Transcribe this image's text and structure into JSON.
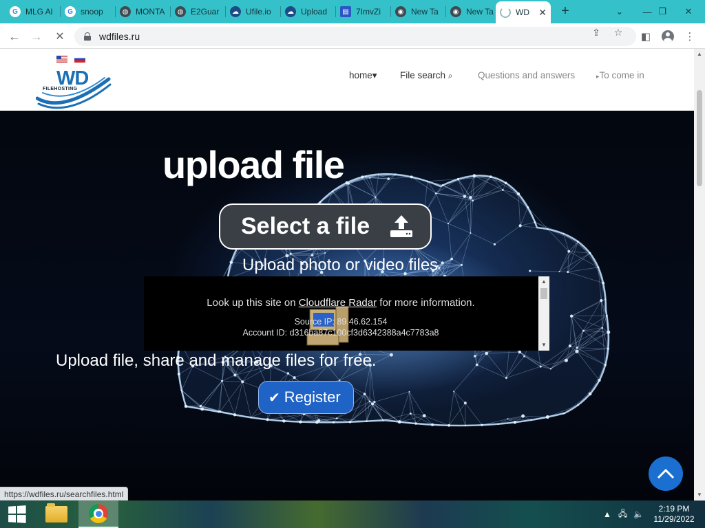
{
  "browser": {
    "tabs": [
      {
        "title": "MLG Al",
        "icon": "google-icon"
      },
      {
        "title": "snoop",
        "icon": "google-icon"
      },
      {
        "title": "MONTA",
        "icon": "globe-icon"
      },
      {
        "title": "E2Guar",
        "icon": "globe-icon"
      },
      {
        "title": "Ufile.io",
        "icon": "cloud-icon"
      },
      {
        "title": "Upload",
        "icon": "cloud-icon"
      },
      {
        "title": "7ImvZi",
        "icon": "document-icon"
      },
      {
        "title": "New Ta",
        "icon": "chrome-icon"
      },
      {
        "title": "New Ta",
        "icon": "chrome-icon"
      },
      {
        "title": "WD",
        "icon": "loading-spinner-icon",
        "active": true
      }
    ],
    "url": "wdfiles.ru",
    "accent": "#35c1c9"
  },
  "site": {
    "logo": {
      "main": "WD",
      "sub": "FILEHOSTING"
    },
    "nav": {
      "home": "home▾",
      "file_search": "File search",
      "qa": "Questions and answers",
      "login": "To come in"
    }
  },
  "hero": {
    "title": "upload file",
    "select_button": "Select a file",
    "subtitle": "Upload photo or video files",
    "tagline": "Upload file, share and manage files for free.",
    "register_button": "Register"
  },
  "cloudflare": {
    "lookup_prefix": "Look up this site on ",
    "lookup_link": "Cloudflare Radar",
    "lookup_suffix": " for more information.",
    "source_ip": "Source IP: 89.46.62.154",
    "account_id": "Account ID: d316ba87c100cf3d6342388a4c7783a8"
  },
  "status_url": "https://wdfiles.ru/searchfiles.html",
  "taskbar": {
    "time": "2:19 PM",
    "date": "11/29/2022"
  }
}
